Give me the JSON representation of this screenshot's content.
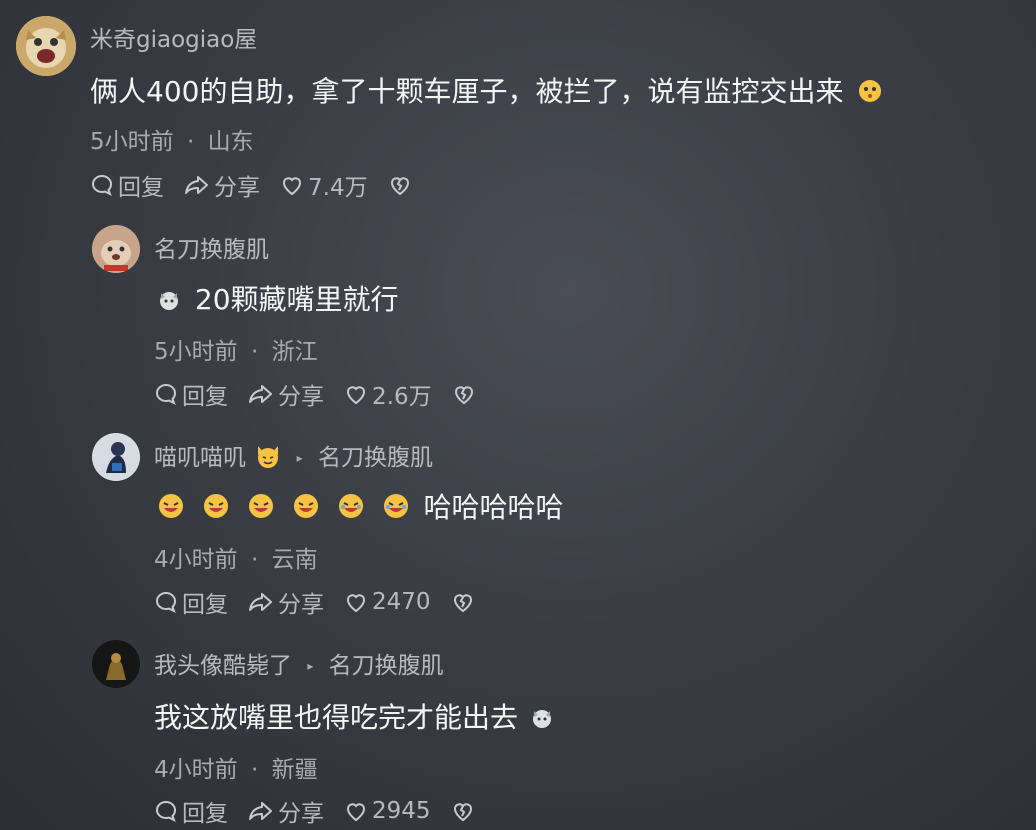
{
  "comments": [
    {
      "username": "米奇giaogiao屋",
      "text": "俩人400的自助，拿了十颗车厘子，被拦了，说有监控交出来",
      "time": "5小时前",
      "location": "山东",
      "reply_label": "回复",
      "share_label": "分享",
      "likes": "7.4万"
    },
    {
      "username": "名刀换腹肌",
      "text": "20颗藏嘴里就行",
      "time": "5小时前",
      "location": "浙江",
      "reply_label": "回复",
      "share_label": "分享",
      "likes": "2.6万"
    },
    {
      "username": "喵叽喵叽",
      "reply_to": "名刀换腹肌",
      "text": "哈哈哈哈哈",
      "time": "4小时前",
      "location": "云南",
      "reply_label": "回复",
      "share_label": "分享",
      "likes": "2470"
    },
    {
      "username": "我头像酷毙了",
      "reply_to": "名刀换腹肌",
      "text": "我这放嘴里也得吃完才能出去",
      "time": "4小时前",
      "location": "新疆",
      "reply_label": "回复",
      "share_label": "分享",
      "likes": "2945"
    }
  ],
  "meta_separator": "·",
  "more_label": "···",
  "colors": {
    "background": "#3a3d44",
    "primary_text": "#f5f5f5",
    "secondary_text": "#b9babd"
  }
}
